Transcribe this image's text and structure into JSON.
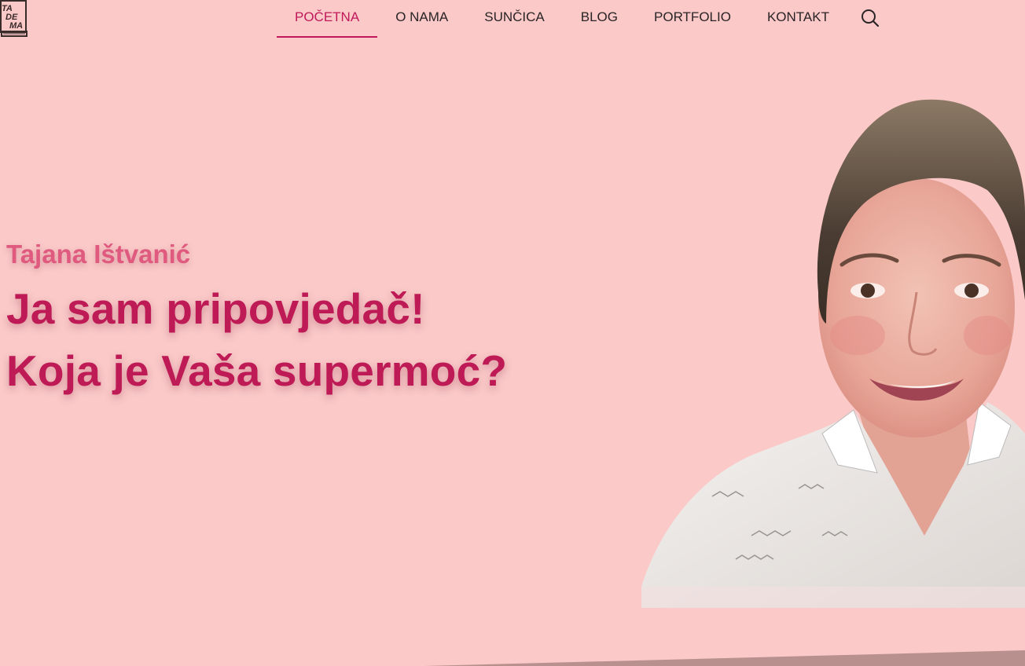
{
  "logo": {
    "letters": [
      "TA",
      "DE",
      "MA"
    ]
  },
  "nav": {
    "items": [
      {
        "label": "POČETNA",
        "active": true
      },
      {
        "label": "O NAMA",
        "active": false
      },
      {
        "label": "SUNČICA",
        "active": false
      },
      {
        "label": "BLOG",
        "active": false
      },
      {
        "label": "PORTFOLIO",
        "active": false
      },
      {
        "label": "KONTAKT",
        "active": false
      }
    ],
    "search_icon": "search-icon"
  },
  "hero": {
    "name": "Tajana Ištvanić",
    "line1": "Ja sam pripovjedač!",
    "line2": "Koja je Vaša supermoć?"
  },
  "colors": {
    "background": "#fac9c8",
    "accent": "#be1a56",
    "name_pink": "#e05a7f",
    "nav_text": "#2a2426",
    "bottom_band": "#b8908e"
  }
}
